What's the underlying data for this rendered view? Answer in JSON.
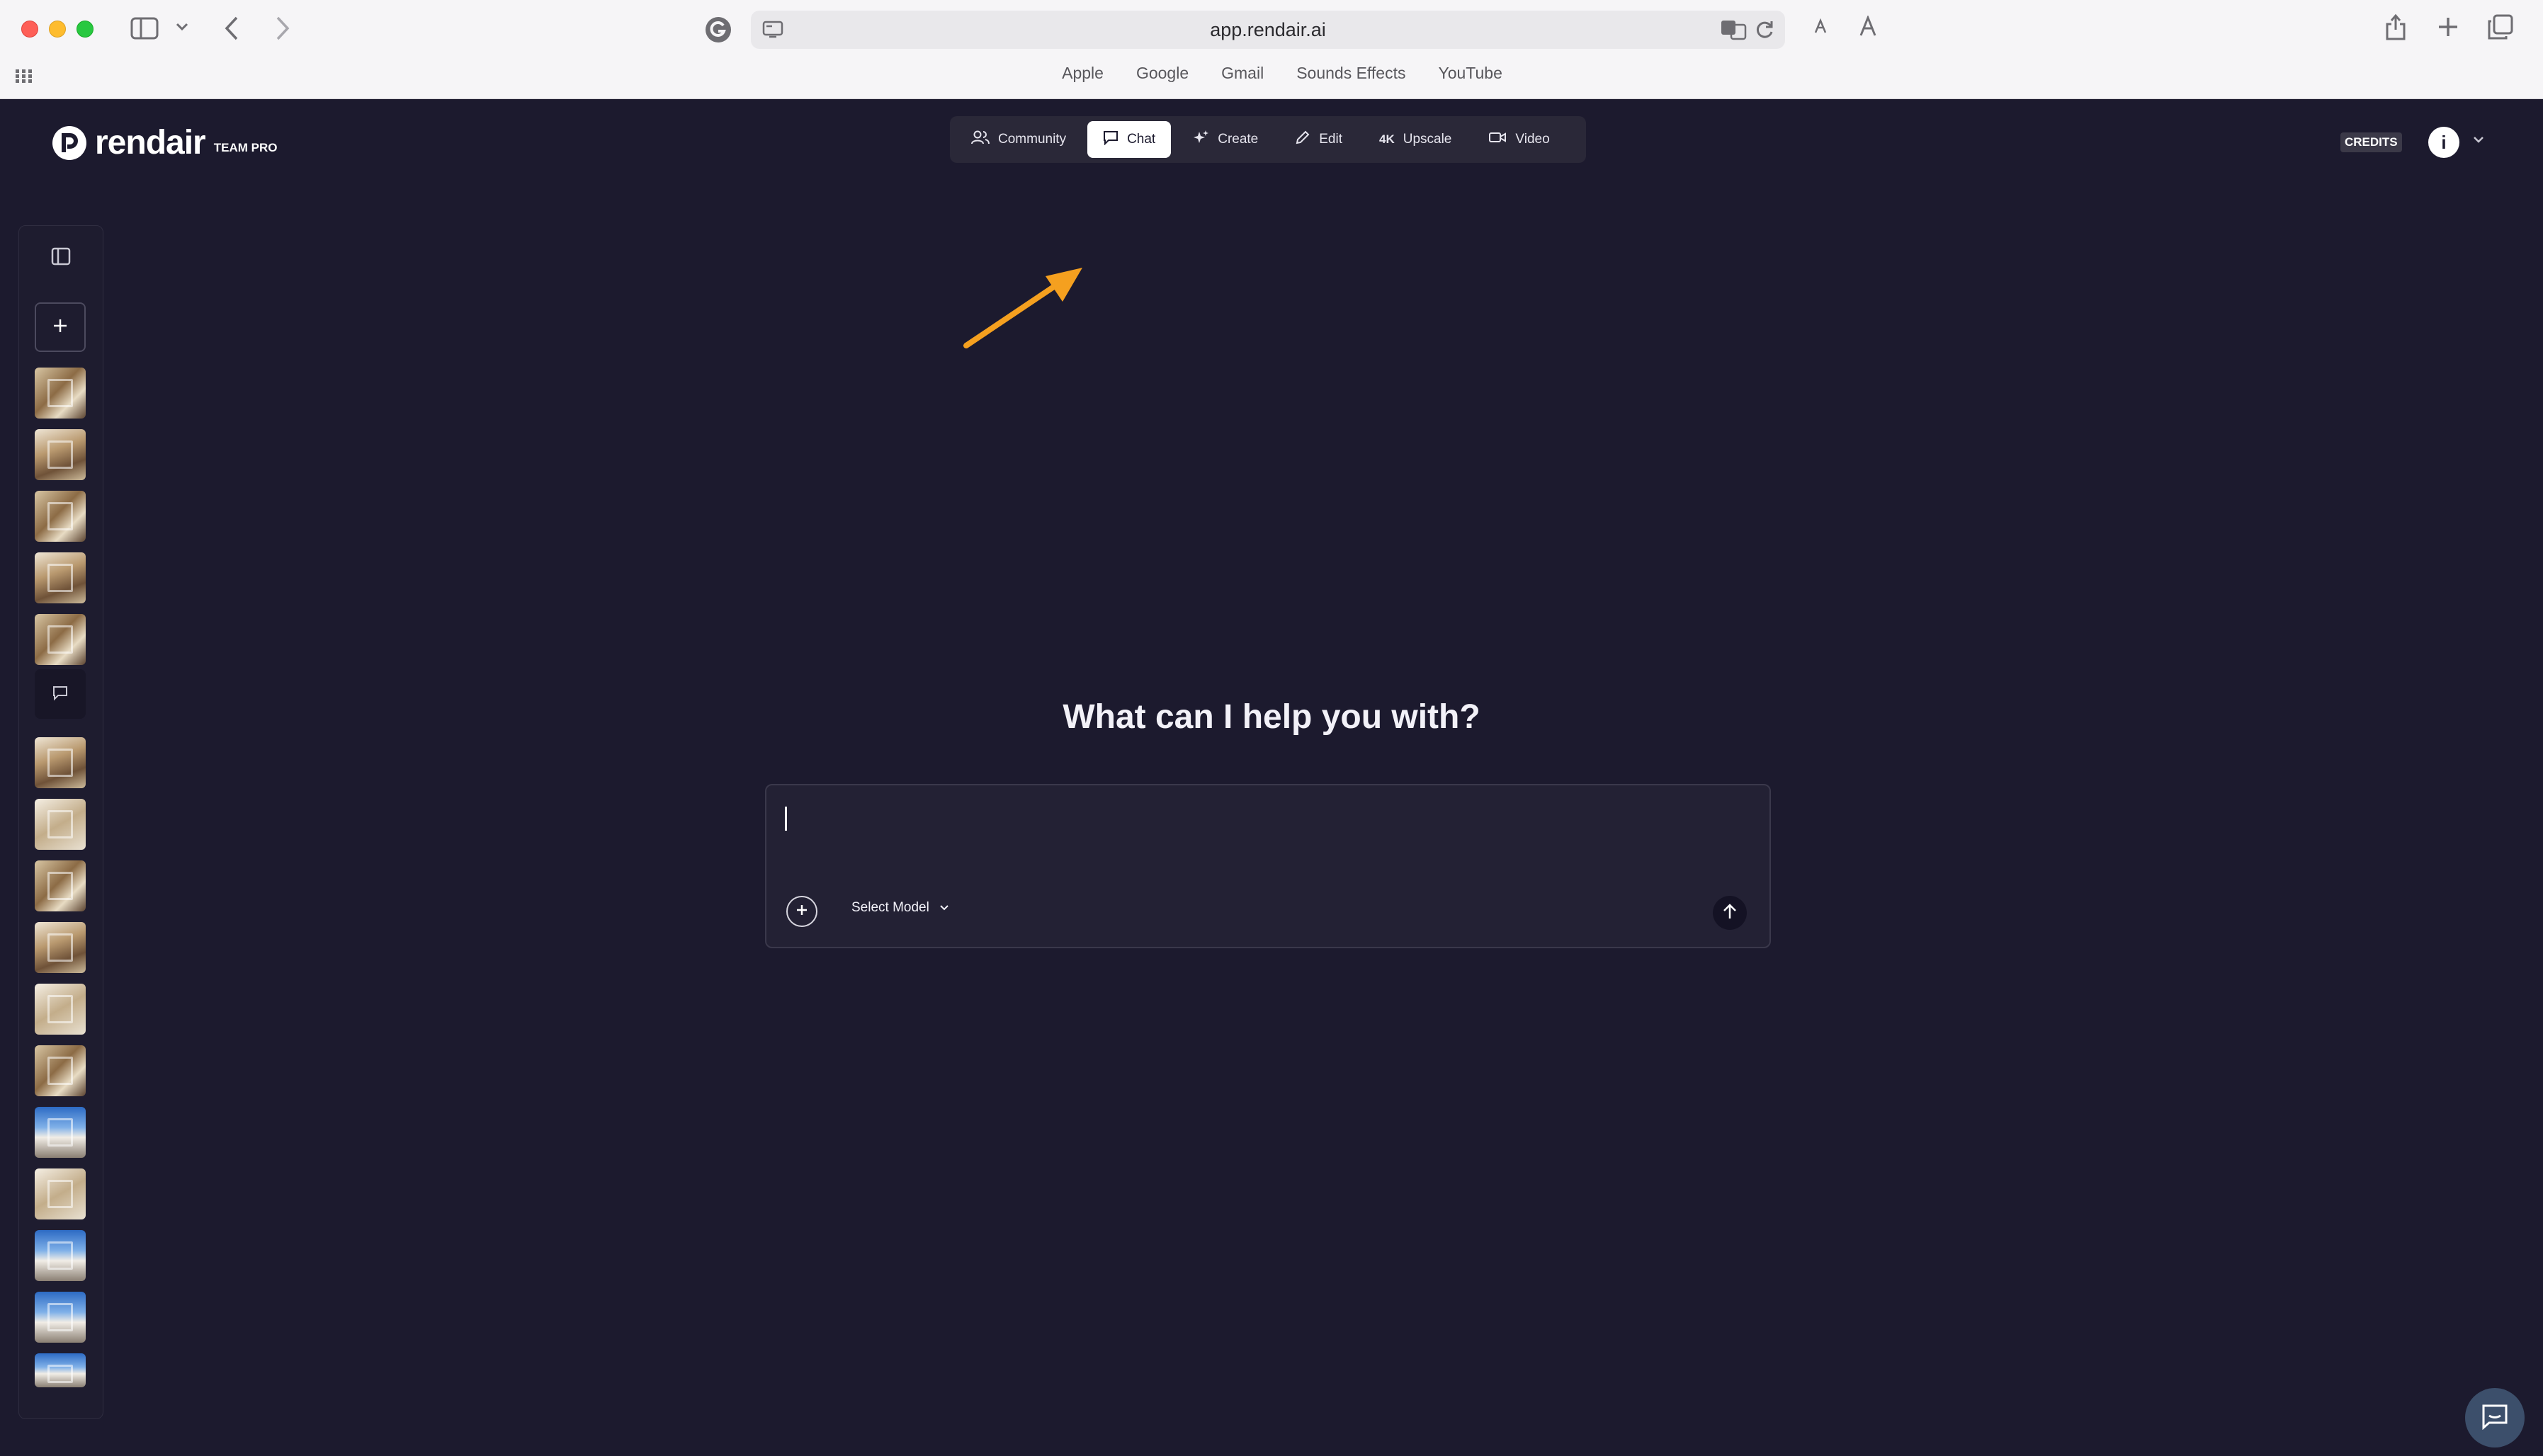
{
  "browser": {
    "url": "app.rendair.ai",
    "favorites": [
      "Apple",
      "Google",
      "Gmail",
      "Sounds Effects",
      "YouTube"
    ]
  },
  "app": {
    "brand": "rendair",
    "tier": "TEAM PRO",
    "nav": [
      {
        "label": "Community",
        "icon": "users-icon",
        "active": false
      },
      {
        "label": "Chat",
        "icon": "chat-bubble-icon",
        "active": true
      },
      {
        "label": "Create",
        "icon": "sparkle-icon",
        "active": false
      },
      {
        "label": "Edit",
        "icon": "pencil-icon",
        "active": false
      },
      {
        "label": "Upscale",
        "icon": "4k-badge",
        "badge": "4K",
        "active": false
      },
      {
        "label": "Video",
        "icon": "video-camera-icon",
        "active": false
      }
    ],
    "credits_label": "CREDITS",
    "avatar_initial": "i"
  },
  "main": {
    "headline": "What can I help you with?",
    "composer": {
      "placeholder": "",
      "value": "",
      "model_label": "Select Model"
    }
  },
  "colors": {
    "background": "#1c1a2e",
    "annotation_arrow": "#f5a01f"
  }
}
